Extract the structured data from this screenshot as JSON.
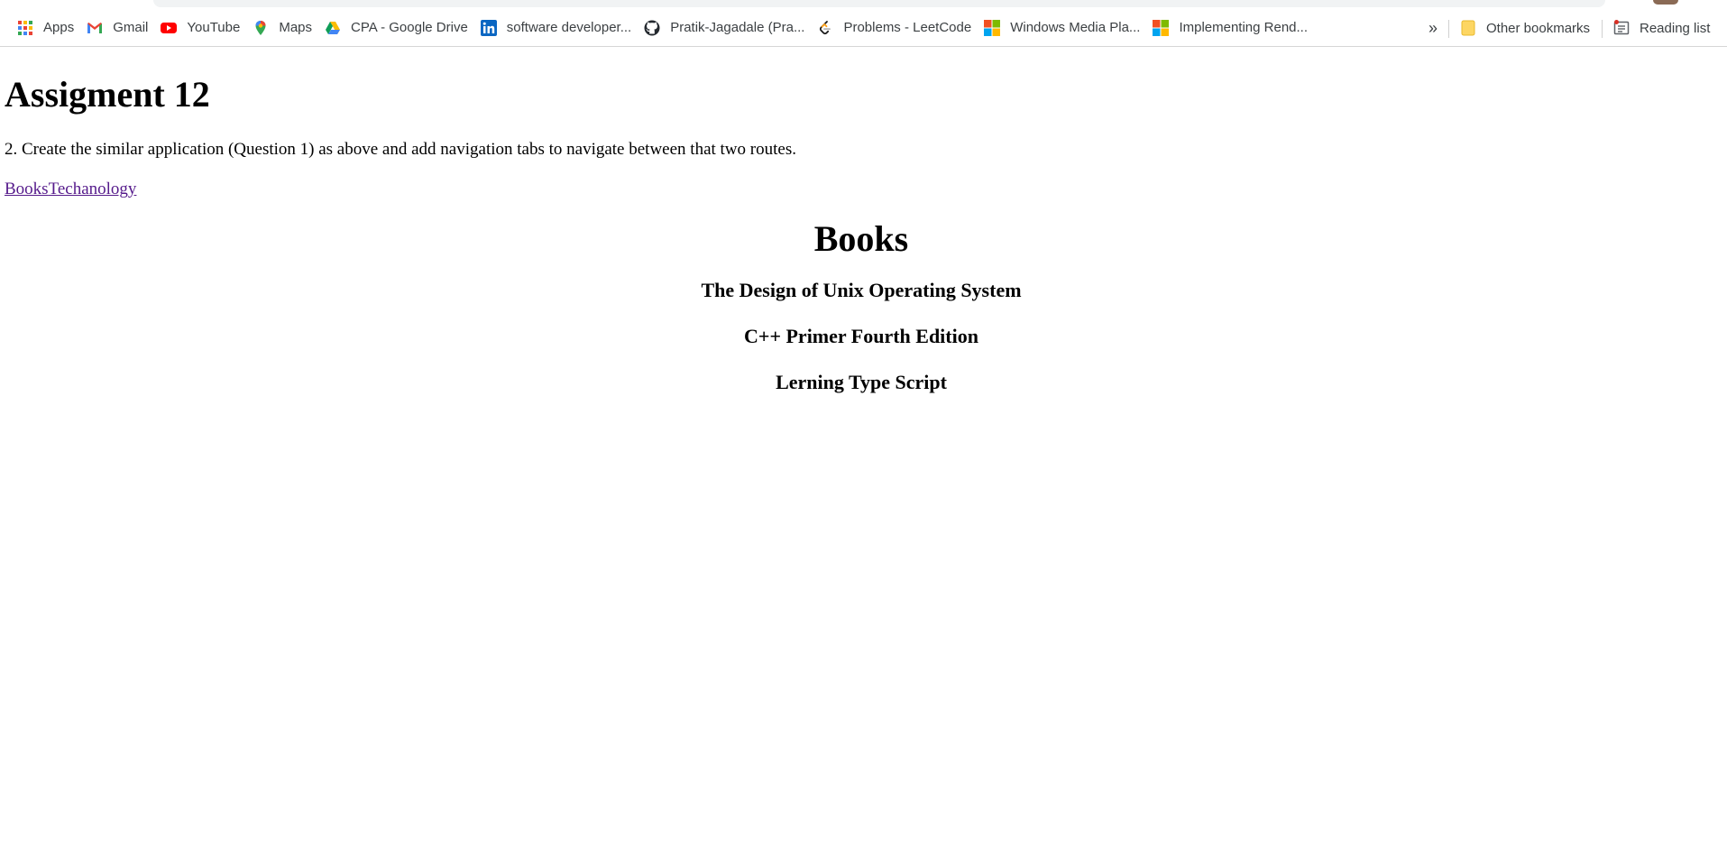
{
  "bookmarks_bar": {
    "items": [
      {
        "label": "Apps",
        "icon": "apps-grid-icon"
      },
      {
        "label": "Gmail",
        "icon": "gmail-icon"
      },
      {
        "label": "YouTube",
        "icon": "youtube-icon"
      },
      {
        "label": "Maps",
        "icon": "maps-pin-icon"
      },
      {
        "label": "CPA - Google Drive",
        "icon": "google-drive-icon"
      },
      {
        "label": "software developer...",
        "icon": "linkedin-icon"
      },
      {
        "label": "Pratik-Jagadale (Pra...",
        "icon": "github-icon"
      },
      {
        "label": "Problems - LeetCode",
        "icon": "leetcode-icon"
      },
      {
        "label": "Windows Media Pla...",
        "icon": "microsoft-icon"
      },
      {
        "label": "Implementing Rend...",
        "icon": "microsoft-icon"
      }
    ],
    "overflow": "»",
    "other_bookmarks": "Other bookmarks",
    "reading_list": "Reading list"
  },
  "page": {
    "title": "Assigment 12",
    "question": "2. Create the similar application (Question 1) as above and add navigation tabs to navigate between that two routes.",
    "nav": {
      "books": "Books",
      "technology": "Techanology"
    },
    "section_title": "Books",
    "books": [
      "The Design of Unix Operating System",
      "C++ Primer Fourth Edition",
      "Lerning Type Script"
    ]
  },
  "colors": {
    "visited_link": "#551a8b",
    "youtube_red": "#ff0000",
    "linkedin_blue": "#0a66c2",
    "folder_yellow": "#fdd663"
  }
}
